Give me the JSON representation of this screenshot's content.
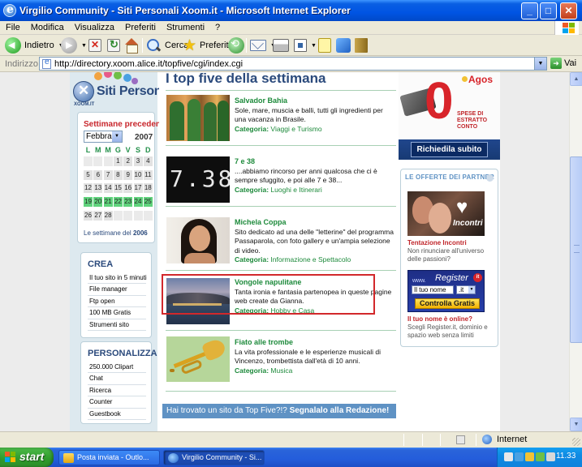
{
  "window": {
    "title": "Virgilio Community - Siti Personali Xoom.it - Microsoft Internet Explorer",
    "minimize": "_",
    "maximize": "□",
    "close": "✕"
  },
  "menubar": {
    "items": [
      "File",
      "Modifica",
      "Visualizza",
      "Preferiti",
      "Strumenti",
      "?"
    ]
  },
  "toolbar": {
    "back_label": "Indietro",
    "search_label": "Cerca",
    "favorites_label": "Preferiti"
  },
  "addressbar": {
    "label": "Indirizzo",
    "url": "http://directory.xoom.alice.it/topfive/cgi/index.cgi",
    "go_label": "Vai"
  },
  "sidebar": {
    "logo_text": "Siti Personali",
    "logo_sub": "XOOM.IT",
    "calendar": {
      "title": "Settimane precedenti",
      "month": "Febbraio",
      "year": "2007",
      "weekdays": [
        "L",
        "M",
        "M",
        "G",
        "V",
        "S",
        "D"
      ],
      "weeks": [
        [
          "",
          "",
          "",
          "1",
          "2",
          "3",
          "4"
        ],
        [
          "5",
          "6",
          "7",
          "8",
          "9",
          "10",
          "11"
        ],
        [
          "12",
          "13",
          "14",
          "15",
          "16",
          "17",
          "18"
        ],
        [
          "19",
          "20",
          "21",
          "22",
          "23",
          "24",
          "25"
        ],
        [
          "26",
          "27",
          "28",
          "",
          "",
          "",
          ""
        ]
      ],
      "highlighted_week": 3,
      "footer_prefix": "Le settimane del ",
      "footer_year": "2006"
    },
    "crea": {
      "title": "CREA",
      "items": [
        "Il tuo sito in 5 minuti",
        "File manager",
        "Ftp open",
        "100 MB Gratis",
        "Strumenti sito"
      ]
    },
    "personalizza": {
      "title": "PERSONALIZZA",
      "items": [
        "250.000 Clipart",
        "Chat",
        "Ricerca",
        "Counter",
        "Guestbook"
      ]
    }
  },
  "main": {
    "headline": "I top five della settimana",
    "category_label": "Categoria:",
    "entries": [
      {
        "title": "Salvador Bahia",
        "description": "Sole, mare, muscia e balli, tutti gli ingredienti per una vacanza in Brasile.",
        "category": "Viaggi e Turismo"
      },
      {
        "title": "7 e 38",
        "description": "....abbiamo rincorso per anni qualcosa che ci è sempre sfuggito, e poi alle 7 e 38...",
        "category": "Luoghi e Itinerari",
        "image_text": "7.38"
      },
      {
        "title": "Michela Coppa",
        "description": "Sito dedicato ad una delle \"letterine\" del programma Passaparola, con foto gallery e un'ampia selezione di video.",
        "category": "Informazione e Spettacolo"
      },
      {
        "title": "Vongole napulitane",
        "description": "Tanta ironia e fantasia partenopea in queste pagine web create da Gianna.",
        "category": "Hobby e Casa"
      },
      {
        "title": "Fiato alle trombe",
        "description": "La vita professionale e le esperienze musicali di Vincenzo, trombettista dall'età di 10 anni.",
        "category": "Musica"
      }
    ],
    "footer_text": "Hai trovato un sito da Top Five?!? ",
    "footer_link": "Segnalalo alla Redazione!"
  },
  "right": {
    "agos": {
      "brand": "Agos",
      "big_number": "0",
      "spese": "SPESE DI ESTRATTO CONTO",
      "cta": "Richiedila subito"
    },
    "partner": {
      "title": "LE OFFERTE DEI PARTNER",
      "incontri_img_label": "Incontri",
      "incontri_title": "Tentazione Incontri",
      "incontri_desc": "Non rinunciare all'universo delle passioni?",
      "register_www": "www.",
      "register_brand": "Register",
      "register_dot": "it",
      "register_input": "Il tuo nome",
      "register_tld": ".it",
      "register_button": "Controlla Gratis",
      "register_question": "Il tuo nome è online?",
      "register_desc": "Scegli Register.it, dominio e spazio web senza limiti"
    }
  },
  "statusbar": {
    "zone": "Internet"
  },
  "taskbar": {
    "start": "start",
    "tasks": [
      "Posta inviata - Outlo...",
      "Virgilio Community - Si..."
    ],
    "active_task": 1,
    "clock": "11.33"
  },
  "colors": {
    "title_blue": "#0054e3",
    "brand_blue": "#2b4a7c",
    "entry_green": "#1d8a3b",
    "highlight_red": "#d2282b",
    "calendar_highlight": "#5fd27c"
  }
}
